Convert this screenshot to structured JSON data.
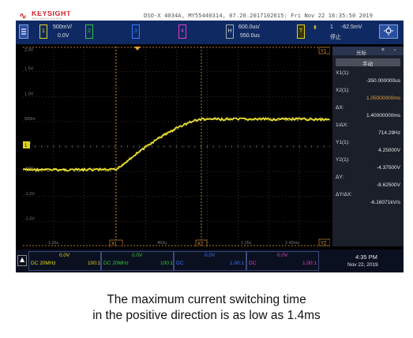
{
  "header": {
    "brand": "KEYSIGHT",
    "brand_sub": "TECHNOLOGIES",
    "info": "DSO-X 4034A, MY55440314, 07.20.2017102615: Fri Nov 22 16:35:50 2019"
  },
  "channels": {
    "ch1_scale": "500mV/",
    "ch1_offset": "0.0V",
    "ch1_num": "1",
    "ch2_num": "2",
    "ch3_num": "3",
    "ch4_num": "4",
    "horiz_label": "H",
    "horiz_scale": "600.0us/",
    "horiz_delay": "550.0us",
    "trig_label": "T",
    "trig_source": "1",
    "trig_level": "-62.5mV",
    "trig_mode": "停止",
    "trig_icon": "trigger-slope-icon"
  },
  "graticule": {
    "y_labels": [
      "2.0V",
      "1.5V",
      "1.0V",
      "500m",
      "0.0",
      "-500",
      "-1.0V",
      "-1.5V"
    ],
    "x_labels": [
      "-1.25s",
      "X1",
      "450u",
      "X2",
      "1.25s",
      "2.45ms"
    ],
    "marker_top": "X1",
    "marker_y2": "Y2",
    "color_trace": "#f2e51c",
    "color_cursor": "#e8a23a"
  },
  "cursors_panel": {
    "title": "光标",
    "mode": "手动",
    "rows": [
      {
        "label": "X1(1):",
        "value": "-350.000000us"
      },
      {
        "label": "X2(1):",
        "value": "1.05000000ms"
      },
      {
        "label": "ΔX:",
        "value": "1.40000000ms"
      },
      {
        "label": "1/ΔX:",
        "value": "714.29Hz"
      },
      {
        "label": "Y1(1):",
        "value": "4.25000V"
      },
      {
        "label": "Y2(1):",
        "value": "-4.37500V"
      },
      {
        "label": "ΔY:",
        "value": "-8.62500V"
      },
      {
        "label": "ΔY/ΔX:",
        "value": "-6.16071kV/s"
      }
    ]
  },
  "bottom_bar": {
    "ch1": {
      "volts": "0.0V",
      "coupling": "DC 20MHz",
      "probe": "100:1"
    },
    "ch2": {
      "volts": "0.0V",
      "coupling": "DC 20MHz",
      "probe": "100:1"
    },
    "ch3": {
      "volts": "0.0V",
      "coupling": "DC",
      "probe": "1.00:1"
    },
    "ch4": {
      "volts": "0.0V",
      "coupling": "DC",
      "probe": "1.00:1"
    },
    "time": "4:35 PM",
    "date": "Nov 22, 2019",
    "colors": {
      "ch1": "#e0d21a",
      "ch2": "#37c437",
      "ch3": "#3c78ff",
      "ch4": "#e040c0"
    }
  },
  "caption": {
    "line1": "The maximum current switching time",
    "line2": "in the positive direction is as low as 1.4ms"
  }
}
